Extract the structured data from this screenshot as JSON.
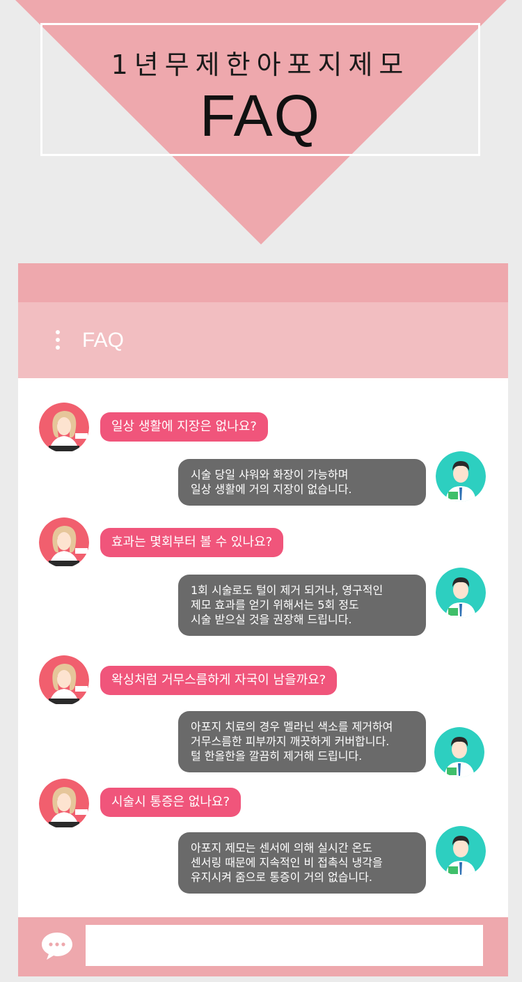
{
  "header": {
    "subtitle": "1년무제한아포지제모",
    "title": "FAQ"
  },
  "panel": {
    "heading": "FAQ",
    "menu_icon": "vertical-dots-icon"
  },
  "faq_items": [
    {
      "question": "일상 생활에 지장은 없나요?",
      "answer_lines": [
        "시술 당일 샤워와 화장이 가능하며",
        "일상 생활에 거의 지장이 없습니다."
      ]
    },
    {
      "question": "효과는 몇회부터 볼 수 있나요?",
      "answer_lines": [
        "1회 시술로도 털이 제거 되거나, 영구적인",
        "제모 효과를 얻기 위해서는 5회 정도",
        "시술 받으실 것을 권장해 드립니다."
      ]
    },
    {
      "question": "왁싱처럼 거무스름하게 자국이 남을까요?",
      "answer_lines": [
        "아포지 치료의 경우 멜라닌 색소를 제거하여",
        "거무스름한 피부까지 깨끗하게 커버합니다.",
        "털 한올한올 깔끔히 제거해 드립니다."
      ]
    },
    {
      "question": "시술시 통증은 없나요?",
      "answer_lines": [
        "아포지 제모는 센서에 의해 실시간 온도",
        "센서링 때문에 지속적인 비 접촉식 냉각을",
        "유지시켜 줌으로 통증이 거의 없습니다."
      ]
    }
  ],
  "footer": {
    "chat_icon": "speech-bubble-icon",
    "input_value": ""
  },
  "colors": {
    "pink_dark": "#eea8ad",
    "pink_light": "#f2bec1",
    "question_bubble": "#f0557b",
    "answer_bubble": "#6a6a6a",
    "background": "#ebebeb"
  }
}
